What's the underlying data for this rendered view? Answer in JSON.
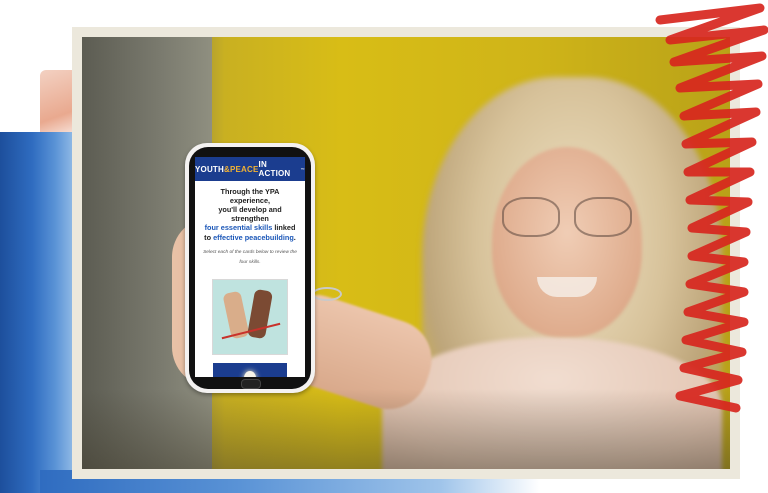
{
  "phone_screen": {
    "banner": {
      "part1": "YOUTH",
      "part2": "&PEACE",
      "part3": " IN ACTION",
      "tm": "™"
    },
    "lead": {
      "line1": "Through the YPA experience,",
      "line2": "you'll develop and strengthen",
      "highlight1": "four essential skills",
      "line3_end": " linked",
      "line4_start": "to ",
      "highlight2": "effective peacebuilding",
      "line4_end": "."
    },
    "instruction": "Select each of the cards below to review the four skills.",
    "card1_icon": "hands-peace-icon",
    "card2_icon": "lightbulb-icon"
  },
  "colors": {
    "banner_blue": "#1b3d8f",
    "banner_accent": "#f2b233",
    "highlight_blue": "#1b57b8",
    "scribble_red": "#d7261e",
    "photo_yellow": "#d8bd16"
  }
}
